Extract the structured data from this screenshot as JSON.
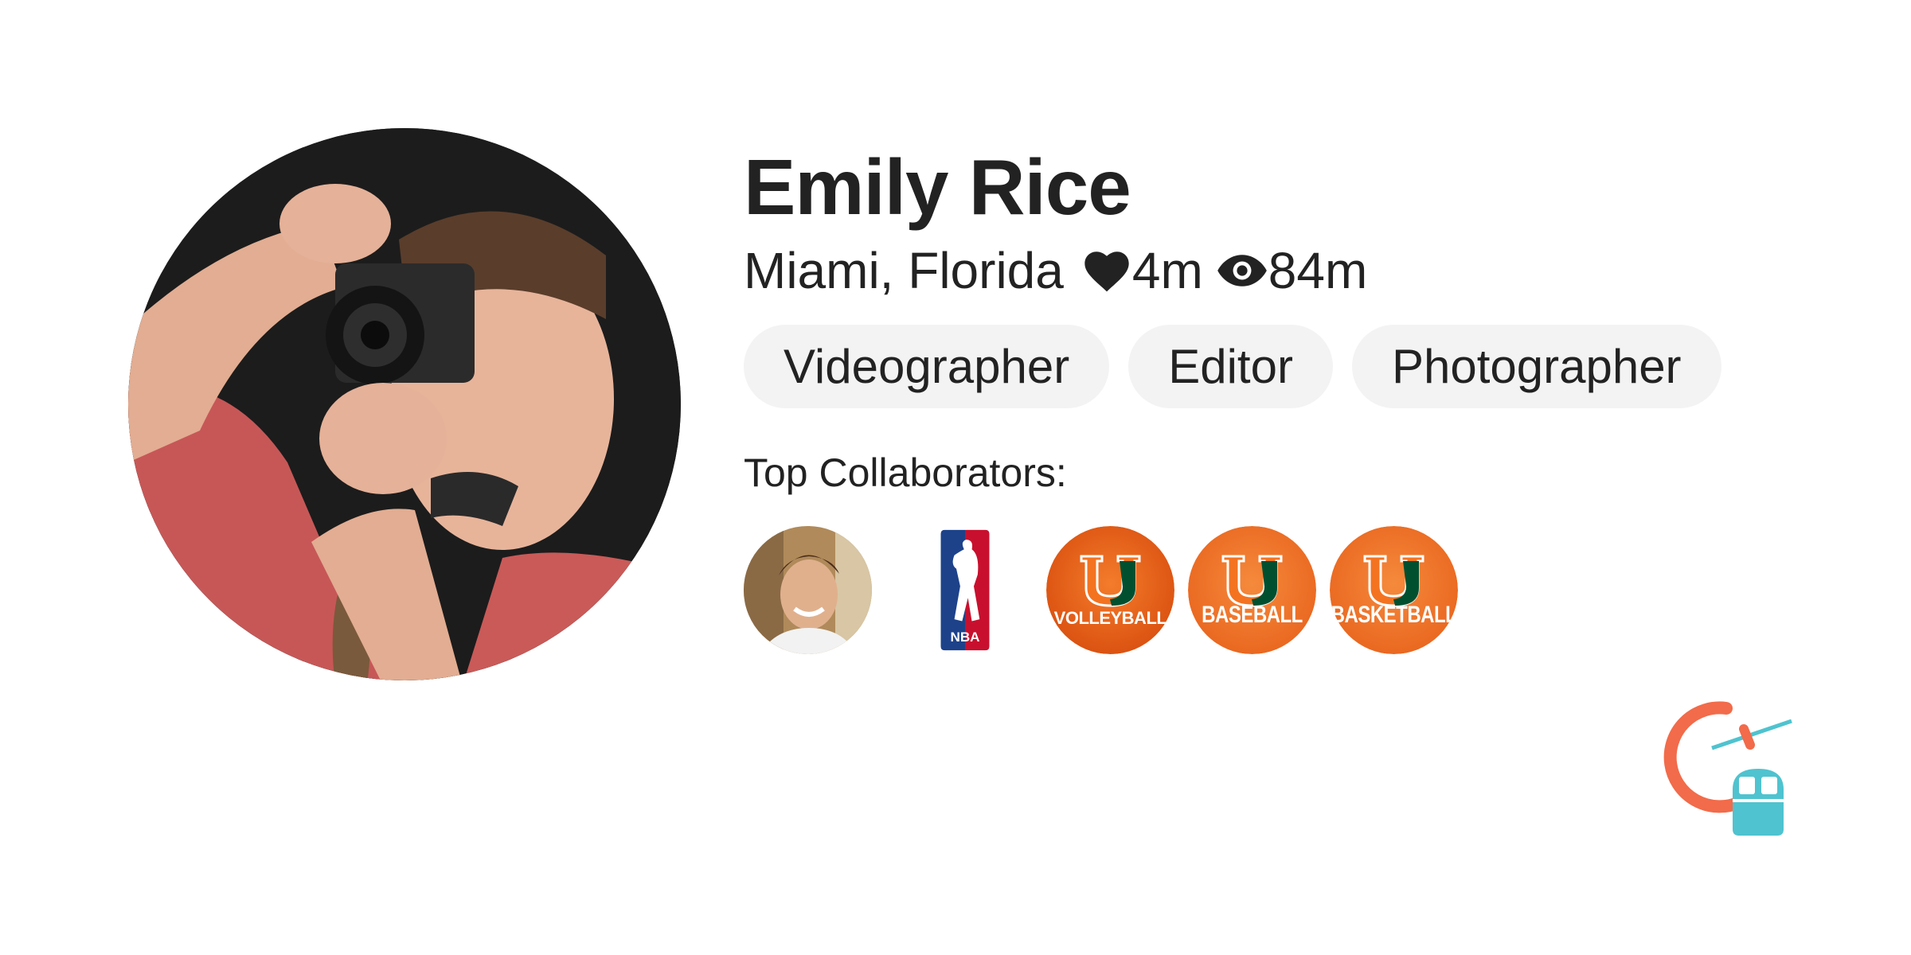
{
  "profile": {
    "name": "Emily Rice",
    "location": "Miami, Florida",
    "likes": "4m",
    "views": "84m",
    "avatar_icon": "profile-photo"
  },
  "tags": [
    "Videographer",
    "Editor",
    "Photographer"
  ],
  "collaborators": {
    "title": "Top Collaborators:",
    "items": [
      {
        "type": "person-photo"
      },
      {
        "type": "nba-logo",
        "label": "NBA"
      },
      {
        "type": "miami-u-logo",
        "label": "VOLLEYBALL"
      },
      {
        "type": "miami-u-logo",
        "label": "BASEBALL"
      },
      {
        "type": "miami-u-logo",
        "label": "BASKETBALL"
      }
    ]
  },
  "colors": {
    "miami_orange": "#F47321",
    "miami_green": "#005030",
    "nba_blue": "#1D428A",
    "nba_red": "#C8102E",
    "tag_bg": "#F3F3F3",
    "brand_orange": "#F26B4A",
    "brand_teal": "#4FC3CF"
  }
}
